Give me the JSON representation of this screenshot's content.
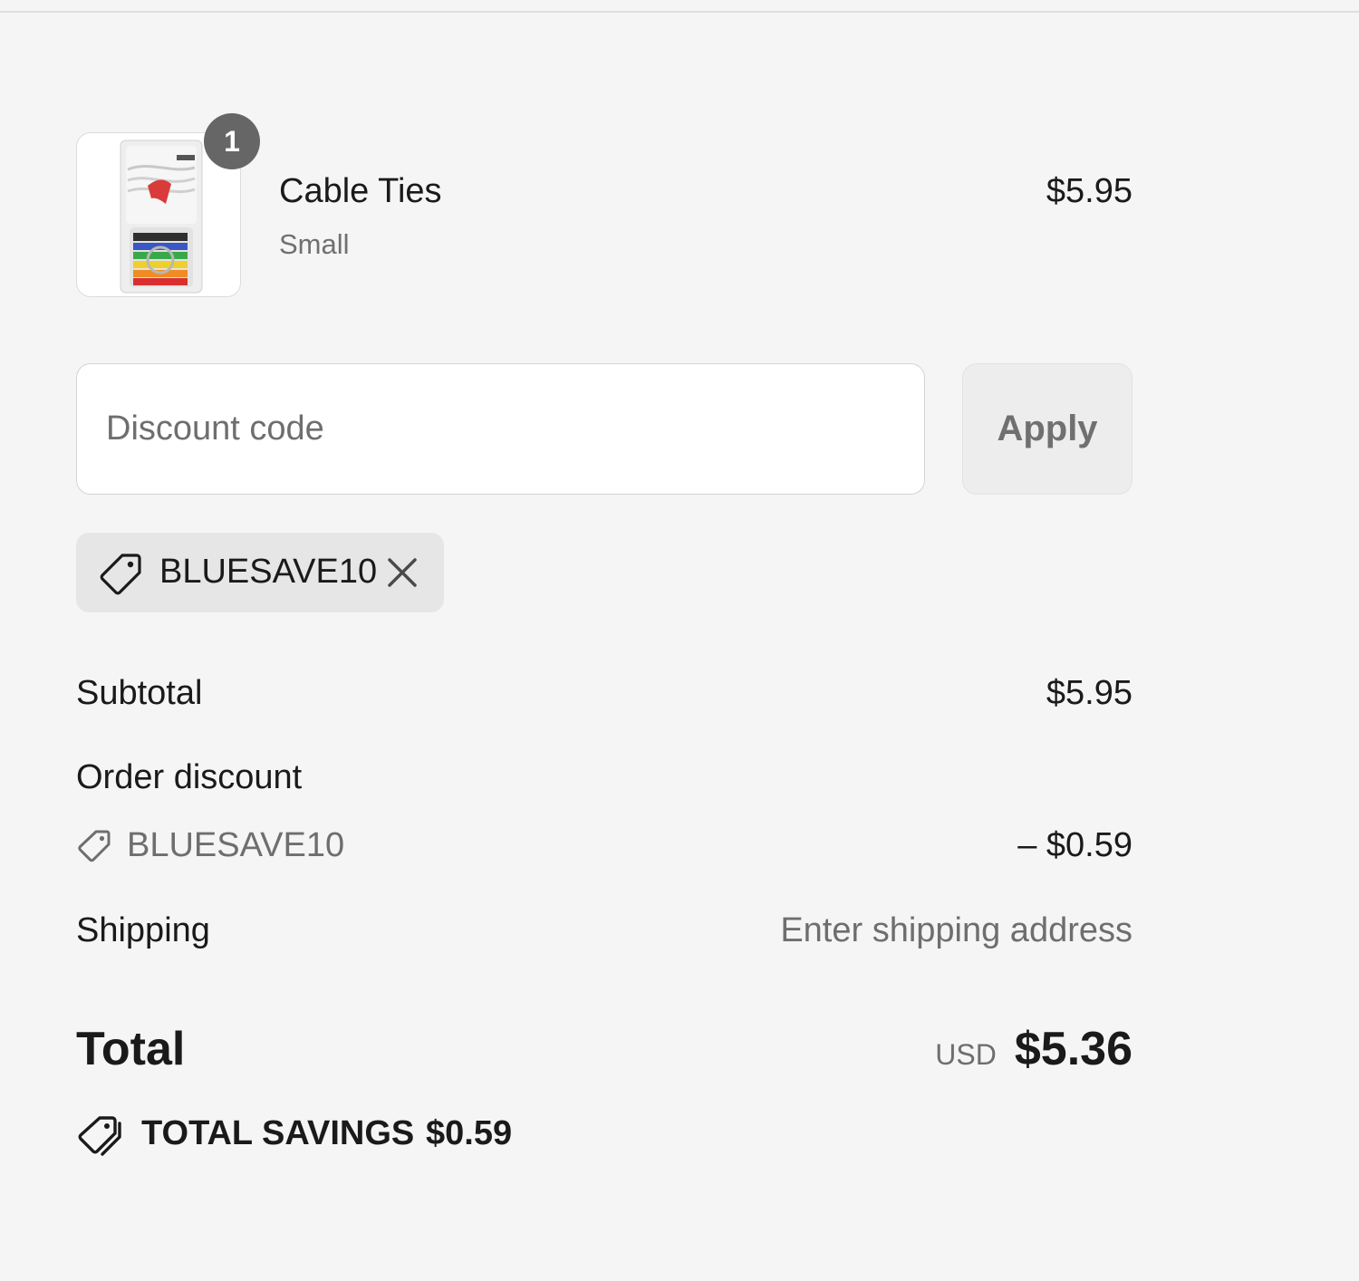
{
  "cart": {
    "items": [
      {
        "name": "Cable Ties",
        "variant": "Small",
        "price": "$5.95",
        "quantity": "1",
        "image_icon": "cable-ties-product-image"
      }
    ]
  },
  "discount": {
    "placeholder": "Discount code",
    "value": "",
    "apply_label": "Apply",
    "applied_code": "BLUESAVE10",
    "tag_icon": "tag-icon",
    "remove_icon": "close-icon"
  },
  "summary": {
    "subtotal_label": "Subtotal",
    "subtotal_value": "$5.95",
    "order_discount_label": "Order discount",
    "order_discount_code": "BLUESAVE10",
    "order_discount_value": "– $0.59",
    "shipping_label": "Shipping",
    "shipping_value": "Enter shipping address",
    "total_label": "Total",
    "total_currency": "USD",
    "total_value": "$5.36",
    "savings_label": "TOTAL SAVINGS",
    "savings_value": "$0.59"
  },
  "colors": {
    "background": "#f5f5f5",
    "text": "#1a1a1a",
    "muted_text": "#6e6e6e",
    "badge": "#666666",
    "chip": "#e6e6e6"
  }
}
